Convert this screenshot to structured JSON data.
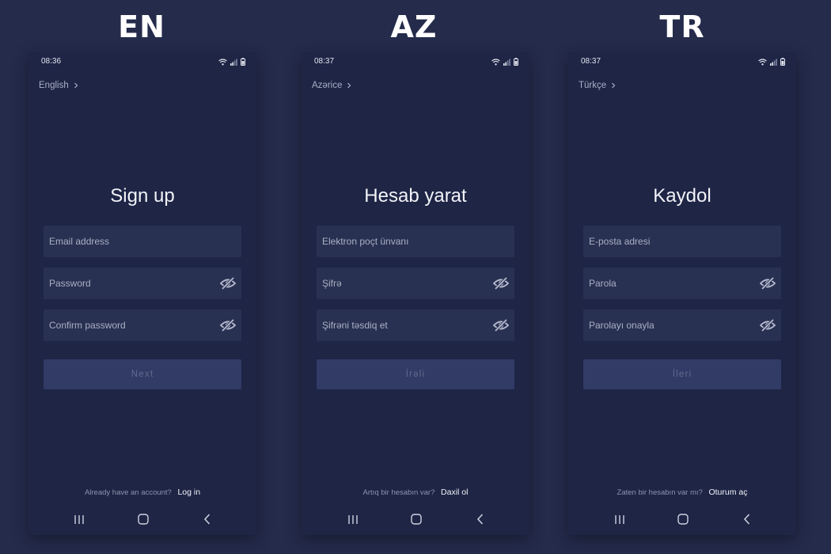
{
  "screens": [
    {
      "heading": "EN",
      "status_time": "08:36",
      "language": "English",
      "title": "Sign up",
      "email_placeholder": "Email address",
      "password_placeholder": "Password",
      "confirm_placeholder": "Confirm password",
      "next_label": "Next",
      "account_question": "Already have an account?",
      "login_label": "Log in"
    },
    {
      "heading": "AZ",
      "status_time": "08:37",
      "language": "Azərice",
      "title": "Hesab yarat",
      "email_placeholder": "Elektron poçt ünvanı",
      "password_placeholder": "Şifrə",
      "confirm_placeholder": "Şifrəni təsdiq et",
      "next_label": "İrəli",
      "account_question": "Artıq bir hesabın var?",
      "login_label": "Daxil ol"
    },
    {
      "heading": "TR",
      "status_time": "08:37",
      "language": "Türkçe",
      "title": "Kaydol",
      "email_placeholder": "E-posta adresi",
      "password_placeholder": "Parola",
      "confirm_placeholder": "Parolayı onayla",
      "next_label": "İleri",
      "account_question": "Zaten bir hesabın var mı?",
      "login_label": "Oturum aç"
    }
  ],
  "icons": {
    "wifi": "wifi-icon",
    "signal": "signal-icon",
    "battery": "battery-icon",
    "chevron": "chevron-right-icon",
    "eye_hidden": "eye-off-icon",
    "recents": "recent-apps-icon",
    "home": "home-icon",
    "back": "back-icon"
  },
  "colors": {
    "page_background": "#242b4b",
    "screen_background": "#1e2545",
    "field_background": "#293152",
    "button_disabled": "#313b66",
    "text_primary": "#f2f3f8"
  }
}
